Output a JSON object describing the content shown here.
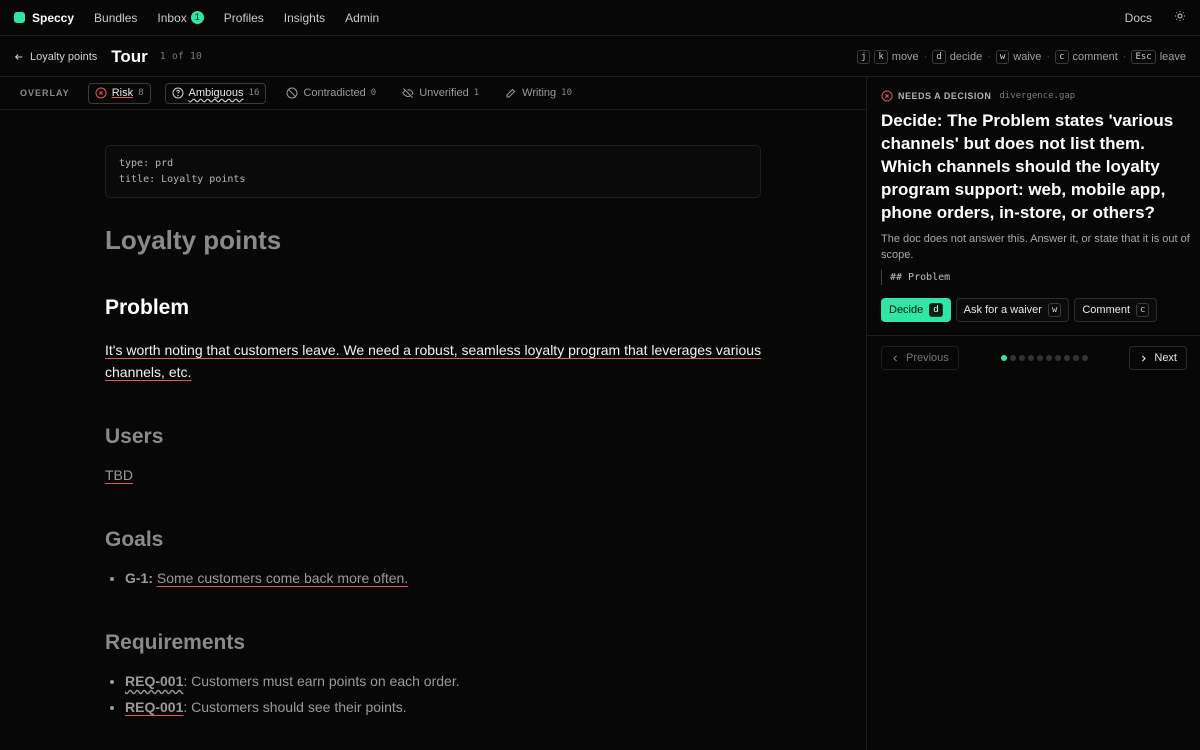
{
  "nav": {
    "brand": "Speccy",
    "items": [
      {
        "label": "Bundles"
      },
      {
        "label": "Inbox",
        "badge": "1"
      },
      {
        "label": "Profiles"
      },
      {
        "label": "Insights"
      },
      {
        "label": "Admin"
      }
    ],
    "docs": "Docs",
    "theme_icon": "sun-icon"
  },
  "tour": {
    "back_label": "Loyalty points",
    "title": "Tour",
    "count": "1 of 10",
    "shortcuts": [
      {
        "keys": [
          "j",
          "k"
        ],
        "label": "move"
      },
      {
        "keys": [
          "d"
        ],
        "label": "decide"
      },
      {
        "keys": [
          "w"
        ],
        "label": "waive"
      },
      {
        "keys": [
          "c"
        ],
        "label": "comment"
      },
      {
        "keys": [
          "Esc"
        ],
        "label": "leave"
      }
    ]
  },
  "overlay": {
    "label": "OVERLAY",
    "chips": [
      {
        "label": "Risk",
        "count": "8",
        "icon": "x-circle-icon",
        "active": true
      },
      {
        "label": "Ambiguous",
        "count": "16",
        "icon": "question-circle-icon",
        "active": true
      },
      {
        "label": "Contradicted",
        "count": "0",
        "icon": "ban-icon",
        "active": false
      },
      {
        "label": "Unverified",
        "count": "1",
        "icon": "eye-off-icon",
        "active": false
      },
      {
        "label": "Writing",
        "count": "10",
        "icon": "pencil-icon",
        "active": false
      }
    ]
  },
  "doc": {
    "frontmatter": [
      "type: prd",
      "title: Loyalty points"
    ],
    "title": "Loyalty points",
    "problem_heading": "Problem",
    "problem_text": "It's worth noting that customers leave. We need a robust, seamless loyalty program that leverages various channels, etc.",
    "users_heading": "Users",
    "users_text": "TBD",
    "goals_heading": "Goals",
    "goals": [
      {
        "id": "G-1:",
        "text": "Some customers come back more often."
      }
    ],
    "requirements_heading": "Requirements",
    "requirements": [
      {
        "id": "REQ-001",
        "text": ": Customers must earn points on each order."
      },
      {
        "id": "REQ-001",
        "text": ": Customers should see their points."
      }
    ]
  },
  "panel": {
    "status": "NEEDS A DECISION",
    "code": "divergence.gap",
    "question": "Decide: The Problem states 'various channels' but does not list them. Which channels should the loyalty program support: web, mobile app, phone orders, in-store, or others?",
    "sub": "The doc does not answer this. Answer it, or state that it is out of scope.",
    "ref": "## Problem",
    "actions": [
      {
        "label": "Decide",
        "key": "d"
      },
      {
        "label": "Ask for a waiver",
        "key": "w"
      },
      {
        "label": "Comment",
        "key": "c"
      }
    ],
    "previous": "Previous",
    "next": "Next",
    "steps_total": 10,
    "step_current": 1
  },
  "colors": {
    "accent": "#2ee6a6",
    "risk": "#e05a5a",
    "background": "#070707"
  }
}
